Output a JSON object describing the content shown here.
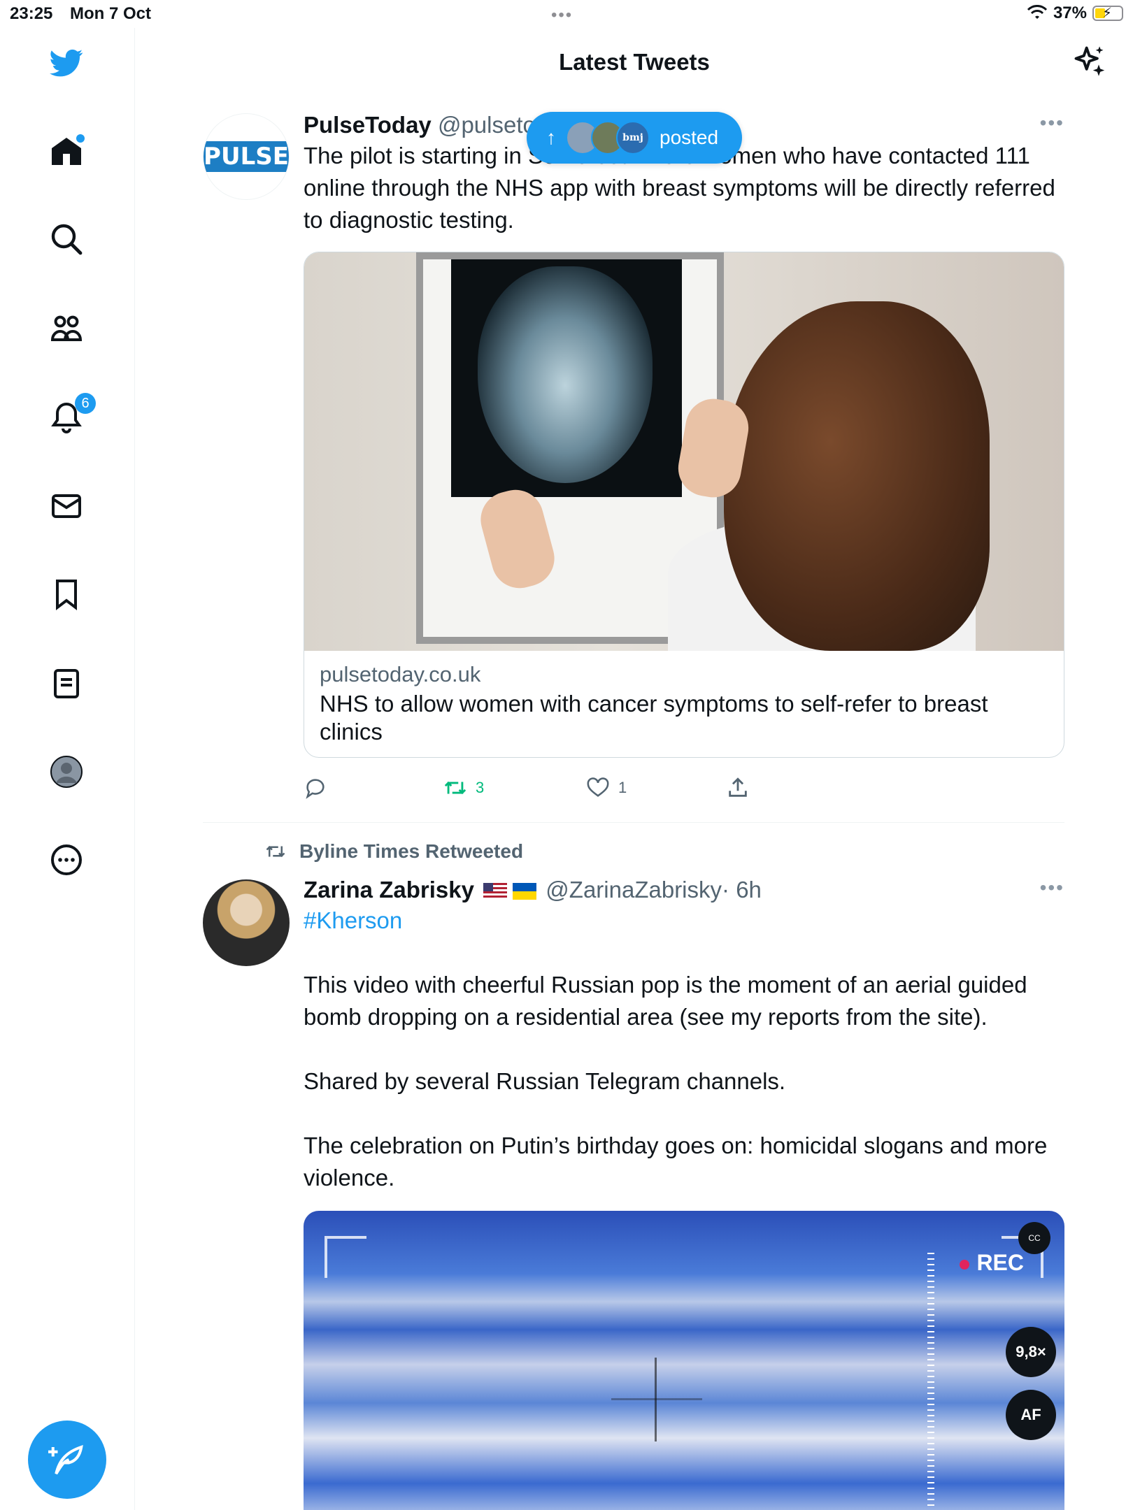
{
  "status_bar": {
    "time": "23:25",
    "date": "Mon 7 Oct",
    "battery_percent": "37%",
    "icons": [
      "wifi-icon",
      "battery-charging-icon"
    ]
  },
  "header": {
    "title": "Latest Tweets",
    "right_icon": "sparkle-icon"
  },
  "sidebar": {
    "items": [
      {
        "name": "twitter-logo",
        "icon": "bird-icon"
      },
      {
        "name": "home",
        "icon": "home-icon",
        "has_dot": true
      },
      {
        "name": "explore",
        "icon": "search-icon"
      },
      {
        "name": "communities",
        "icon": "people-icon"
      },
      {
        "name": "notifications",
        "icon": "bell-icon",
        "badge": "6"
      },
      {
        "name": "messages",
        "icon": "mail-icon"
      },
      {
        "name": "bookmarks",
        "icon": "bookmark-icon"
      },
      {
        "name": "lists",
        "icon": "list-icon"
      },
      {
        "name": "profile",
        "icon": "avatar-icon"
      },
      {
        "name": "more",
        "icon": "more-circle-icon"
      }
    ],
    "compose_icon": "compose-tweet-icon"
  },
  "posted_pill": {
    "label": "posted",
    "avatar3_text": "bmj"
  },
  "tweets": [
    {
      "name": "PulseToday",
      "handle": "@pulseto",
      "avatar_text": "PULSE",
      "text": "The pilot is starting in Somerset where women who have contacted 111 online through the NHS app with breast symptoms will be directly referred to diagnostic testing.",
      "card": {
        "domain": "pulsetoday.co.uk",
        "title": "NHS to allow women with cancer symptoms to self-refer to breast clinics"
      },
      "actions": {
        "reply": "",
        "retweets": "3",
        "likes": "1"
      }
    },
    {
      "retweeted_by": "Byline Times Retweeted",
      "name": "Zarina Zabrisky",
      "handle": "@ZarinaZabrisky",
      "time": "· 6h",
      "hashtag": "#Kherson",
      "paragraphs": [
        "This video with cheerful Russian pop is the moment of an aerial guided bomb dropping on a residential area (see my reports from the site).",
        "Shared by several Russian Telegram channels.",
        "The celebration on Putin’s birthday goes on: homicidal slogans and more violence."
      ],
      "video": {
        "rec_label": "REC",
        "zoom_label": "9,8×",
        "af_label": "AF",
        "cc_label": "CC"
      }
    }
  ],
  "colors": {
    "accent": "#1d9bf0",
    "retweet": "#00ba7c",
    "secondary_text": "#536471"
  }
}
